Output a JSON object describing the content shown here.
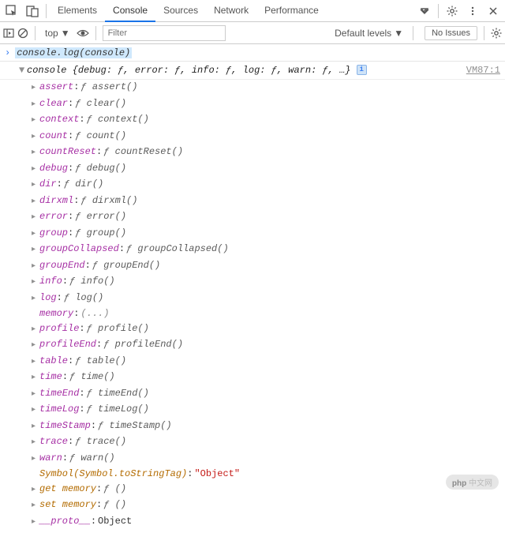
{
  "tabs": {
    "elements": "Elements",
    "console": "Console",
    "sources": "Sources",
    "network": "Network",
    "performance": "Performance"
  },
  "row2": {
    "ctx": "top",
    "filter_ph": "Filter",
    "levels": "Default levels",
    "issues": "No Issues"
  },
  "cmd": "console.log(console)",
  "obj_summary": {
    "head": "console",
    "body": "{debug: ƒ, error: ƒ, info: ƒ, log: ƒ, warn: ƒ, …}"
  },
  "source": "VM87:1",
  "props": [
    {
      "n": "assert",
      "v": "ƒ assert()"
    },
    {
      "n": "clear",
      "v": "ƒ clear()"
    },
    {
      "n": "context",
      "v": "ƒ context()"
    },
    {
      "n": "count",
      "v": "ƒ count()"
    },
    {
      "n": "countReset",
      "v": "ƒ countReset()"
    },
    {
      "n": "debug",
      "v": "ƒ debug()"
    },
    {
      "n": "dir",
      "v": "ƒ dir()"
    },
    {
      "n": "dirxml",
      "v": "ƒ dirxml()"
    },
    {
      "n": "error",
      "v": "ƒ error()"
    },
    {
      "n": "group",
      "v": "ƒ group()"
    },
    {
      "n": "groupCollapsed",
      "v": "ƒ groupCollapsed()"
    },
    {
      "n": "groupEnd",
      "v": "ƒ groupEnd()"
    },
    {
      "n": "info",
      "v": "ƒ info()"
    },
    {
      "n": "log",
      "v": "ƒ log()"
    },
    {
      "n": "memory",
      "v": "(...)",
      "notri": true,
      "cls": "dots"
    },
    {
      "n": "profile",
      "v": "ƒ profile()"
    },
    {
      "n": "profileEnd",
      "v": "ƒ profileEnd()"
    },
    {
      "n": "table",
      "v": "ƒ table()"
    },
    {
      "n": "time",
      "v": "ƒ time()"
    },
    {
      "n": "timeEnd",
      "v": "ƒ timeEnd()"
    },
    {
      "n": "timeLog",
      "v": "ƒ timeLog()"
    },
    {
      "n": "timeStamp",
      "v": "ƒ timeStamp()"
    },
    {
      "n": "trace",
      "v": "ƒ trace()"
    },
    {
      "n": "warn",
      "v": "ƒ warn()"
    },
    {
      "n": "Symbol(Symbol.toStringTag)",
      "v": "\"Object\"",
      "notri": true,
      "ncls": "sym",
      "cls": "str"
    },
    {
      "n": "get memory",
      "v": "ƒ ()",
      "ncls": "acc"
    },
    {
      "n": "set memory",
      "v": "ƒ ()",
      "ncls": "acc"
    },
    {
      "n": "__proto__",
      "v": "Object",
      "cls": "obj"
    }
  ],
  "watermark": {
    "a": "php",
    "b": "中文网"
  }
}
